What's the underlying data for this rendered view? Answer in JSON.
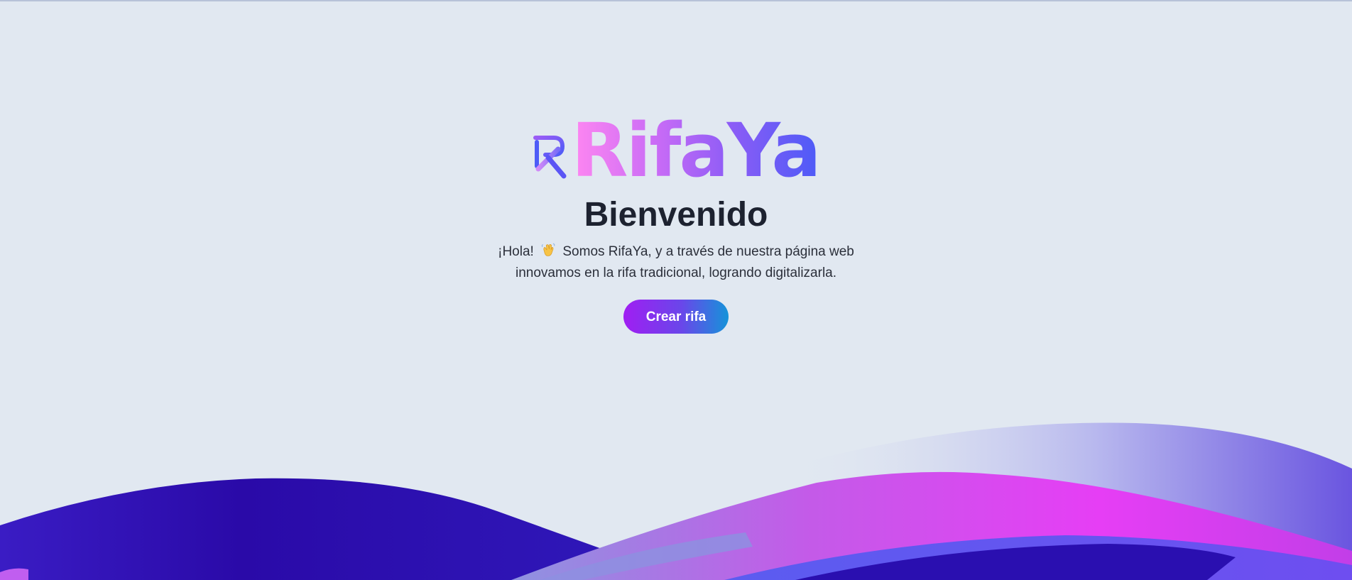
{
  "brand": {
    "name": "RifaYa",
    "logo_icon": "rifaya-logo-mark-icon"
  },
  "hero": {
    "title": "Bienvenido",
    "greeting": "¡Hola!",
    "emoji_icon": "waving-hand-icon",
    "line1_rest": "Somos RifaYa, y a través de nuestra página web",
    "line2": "innovamos en la rifa tradicional, logrando digitalizarla.",
    "cta_label": "Crear rifa"
  },
  "colors": {
    "background": "#e1e8f1",
    "logo_gradient": [
      "#ff87f1",
      "#c86bf6",
      "#8b5cf6",
      "#4d5bf7"
    ],
    "cta_gradient": [
      "#a01ef2",
      "#6a46ea",
      "#1593d9"
    ],
    "wave_dark": "#2a0fb0",
    "wave_pink": "#e63ef5",
    "wave_light": "#8e8ff0"
  }
}
